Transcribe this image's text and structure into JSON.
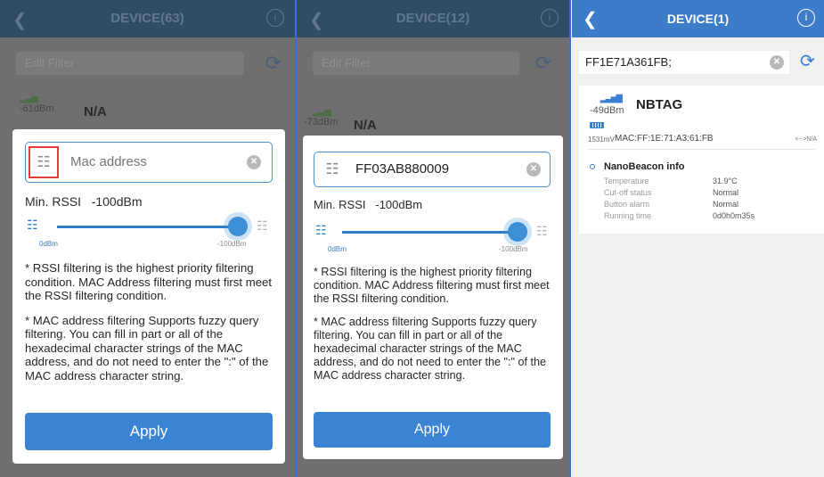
{
  "screens": [
    {
      "header": {
        "back_icon": "chevron-left-icon",
        "title": "DEVICE(63)",
        "info_icon": "info-circle-icon"
      },
      "filter": {
        "placeholder": "Edit Filter"
      },
      "device": {
        "rssi": "-61dBm",
        "name": "N/A"
      },
      "modal": {
        "mac_value": "",
        "mac_placeholder": "Mac address",
        "scan_highlighted": true,
        "rssi_label": "Min. RSSI",
        "rssi_value": "-100dBm",
        "slider_fraction": 1.0,
        "tick_left": "0dBm",
        "tick_right": "-100dBm",
        "help_1": "* RSSI filtering is the highest priority filtering condition. MAC Address filtering must first meet the RSSI filtering condition.",
        "help_2": "* MAC address filtering Supports fuzzy query filtering. You can fill in part or all of the hexadecimal character strings of the MAC address, and do not need to enter the \":\" of the MAC address character string.",
        "apply_label": "Apply"
      }
    },
    {
      "header": {
        "back_icon": "chevron-left-icon",
        "title": "DEVICE(12)",
        "info_icon": "info-circle-icon"
      },
      "filter": {
        "placeholder": "Edit Filter"
      },
      "device": {
        "rssi": "-73dBm",
        "name": "N/A"
      },
      "modal": {
        "mac_value": "FF03AB880009",
        "mac_placeholder": "Mac address",
        "scan_highlighted": false,
        "rssi_label": "Min. RSSI",
        "rssi_value": "-100dBm",
        "slider_fraction": 1.0,
        "tick_left": "0dBm",
        "tick_right": "-100dBm",
        "help_1": "* RSSI filtering is the highest priority filtering condition. MAC Address filtering must first meet the RSSI filtering condition.",
        "help_2": "* MAC address filtering Supports fuzzy query filtering. You can fill in part or all of the hexadecimal character strings of the MAC address, and do not need to enter the \":\" of the MAC address character string.",
        "apply_label": "Apply"
      }
    },
    {
      "header": {
        "back_icon": "chevron-left-icon",
        "title": "DEVICE(1)",
        "info_icon": "info-circle-icon"
      },
      "search": {
        "value": "FF1E71A361FB;",
        "clear_icon": "clear-circle-icon",
        "refresh_icon": "refresh-icon"
      },
      "device": {
        "rssi": "-49dBm",
        "name": "NBTAG",
        "battery_mv": "1531mV",
        "mac": "MAC:FF:1E:71:A3:61:FB",
        "link": "<-->N/A",
        "info_title": "NanoBeacon info",
        "info": [
          {
            "key": "Temperature",
            "value": "31.9°C"
          },
          {
            "key": "Cut-off status",
            "value": "Normal"
          },
          {
            "key": "Button alarm",
            "value": "Normal"
          },
          {
            "key": "Running time",
            "value": "0d0h0m35s"
          }
        ]
      }
    }
  ],
  "colors": {
    "primary": "#3d7cc8",
    "apply": "#3b83d3",
    "highlight": "#e53b3b",
    "divider": "#3a6ed8"
  }
}
